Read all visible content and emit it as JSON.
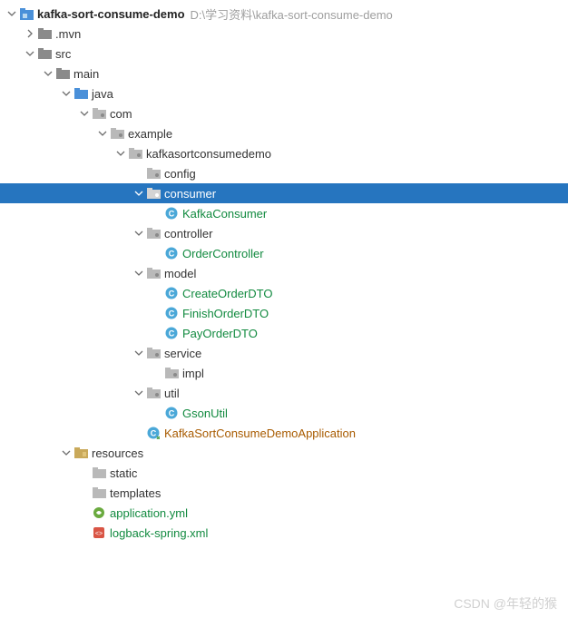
{
  "root": {
    "name": "kafka-sort-consume-demo",
    "path_hint": "D:\\学习资料\\kafka-sort-consume-demo"
  },
  "nodes": {
    "mvn": ".mvn",
    "src": "src",
    "main": "main",
    "java": "java",
    "com": "com",
    "example": "example",
    "pkg": "kafkasortconsumedemo",
    "config": "config",
    "consumer": "consumer",
    "kafka_consumer": "KafkaConsumer",
    "controller": "controller",
    "order_controller": "OrderController",
    "model": "model",
    "create_order_dto": "CreateOrderDTO",
    "finish_order_dto": "FinishOrderDTO",
    "pay_order_dto": "PayOrderDTO",
    "service": "service",
    "impl": "impl",
    "util": "util",
    "gson_util": "GsonUtil",
    "app_class": "KafkaSortConsumeDemoApplication",
    "resources": "resources",
    "static": "static",
    "templates": "templates",
    "application_yml": "application.yml",
    "logback_xml": "logback-spring.xml"
  },
  "watermark": "CSDN @年轻的猴"
}
